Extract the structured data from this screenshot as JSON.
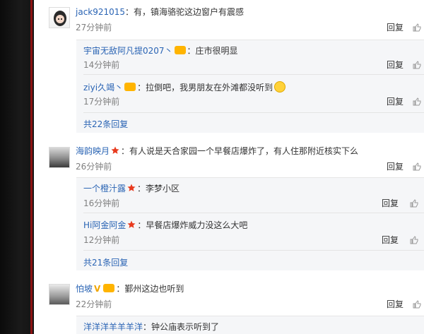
{
  "comments": [
    {
      "user": "jack921015",
      "text": "：有，镇海骆驼这边窗户有震感",
      "time": "27分钟前",
      "reply_label": "回复",
      "replies": [
        {
          "user": "宇宙无敌阿凡提0207丶",
          "text": "：庄市很明显",
          "time": "14分钟前",
          "reply_label": "回复"
        },
        {
          "user": "ziyi久竭丶",
          "text": "：拉倒吧，我男朋友在外滩都没听到",
          "time": "17分钟前",
          "reply_label": "回复"
        }
      ],
      "more_replies": "共22条回复"
    },
    {
      "user": "海韵映月",
      "text": "：有人说是天合家园一个早餐店爆炸了，有人住那附近核实下么",
      "time": "26分钟前",
      "reply_label": "回复",
      "replies": [
        {
          "user": "一个橙汁露",
          "text": "：李梦小区",
          "time": "16分钟前",
          "reply_label": "回复"
        },
        {
          "user": "Hi阿金阿金",
          "text": "：早餐店爆炸威力没这么大吧",
          "time": "12分钟前",
          "reply_label": "回复"
        }
      ],
      "more_replies": "共21条回复"
    },
    {
      "user": "怕坡",
      "badge": "V",
      "text": "：鄞州这边也听到",
      "time": "22分钟前",
      "reply_label": "回复",
      "replies": [
        {
          "user": "洋洋洋羊羊羊洋",
          "text": "：钟公庙表示听到了"
        }
      ]
    }
  ],
  "icons": {
    "like": "thumbs-up-icon",
    "vip": "vip-icon",
    "star": "star-icon",
    "emoji": "smirk-emoji-icon"
  },
  "colors": {
    "username": "#2a64b4",
    "star": "#e83a1e",
    "vip": "#ffb400",
    "left_bar": "#141414",
    "red_rule": "#8c1111"
  }
}
